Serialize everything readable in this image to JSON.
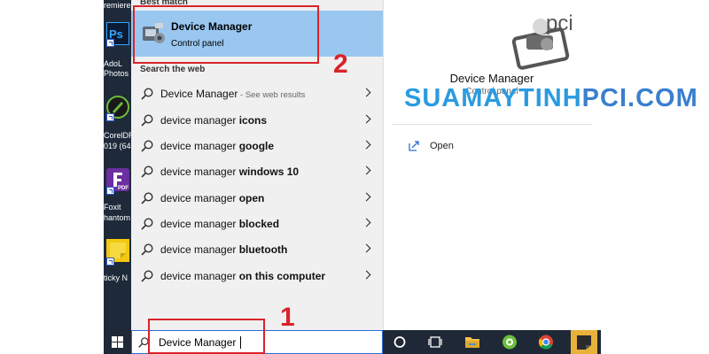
{
  "colors": {
    "accent_highlight": "#99c7f0",
    "annotation_red": "#d9232a",
    "taskbar_bg": "#1f2836",
    "watermark_blue": "#2b9be0"
  },
  "desktop": {
    "items": [
      {
        "label": "remiere",
        "icon": "premiere-icon"
      },
      {
        "label": "AdoL",
        "icon": "photoshop-icon"
      },
      {
        "label": "Photos",
        "icon": "photoshop-icon"
      },
      {
        "label": "CorelDR",
        "icon": "coreldraw-icon"
      },
      {
        "label": "019 (64",
        "icon": "coreldraw-icon"
      },
      {
        "label": "Foxit",
        "icon": "foxit-pdf-icon"
      },
      {
        "label": "hantom",
        "icon": "foxit-pdf-icon"
      },
      {
        "label": "ticky N",
        "icon": "sticky-notes-icon"
      }
    ]
  },
  "best_match": {
    "header": "Best match",
    "title": "Device Manager",
    "subtitle": "Control panel",
    "icon": "device-manager-icon"
  },
  "web": {
    "header": "Search the web",
    "results": [
      {
        "prefix": "Device Manager",
        "bold": "",
        "suffix": " - See web results"
      },
      {
        "prefix": "device manager ",
        "bold": "icons",
        "suffix": ""
      },
      {
        "prefix": "device manager ",
        "bold": "google",
        "suffix": ""
      },
      {
        "prefix": "device manager ",
        "bold": "windows 10",
        "suffix": ""
      },
      {
        "prefix": "device manager ",
        "bold": "open",
        "suffix": ""
      },
      {
        "prefix": "device manager ",
        "bold": "blocked",
        "suffix": ""
      },
      {
        "prefix": "device manager ",
        "bold": "bluetooth",
        "suffix": ""
      },
      {
        "prefix": "device manager ",
        "bold": "on this computer",
        "suffix": ""
      }
    ]
  },
  "preview": {
    "title": "Device Manager",
    "subtitle": "Control panel",
    "actions": [
      {
        "label": "Open",
        "icon": "open-icon"
      }
    ]
  },
  "watermark": {
    "part1": "SUAMAYTINH",
    "part2": "PCI.COM",
    "logo_text": "pci"
  },
  "search": {
    "value": "Device Manager"
  },
  "annotations": {
    "step1": "1",
    "step2": "2"
  },
  "taskbar": {
    "items": [
      {
        "icon": "cortana-icon"
      },
      {
        "icon": "task-view-icon"
      },
      {
        "icon": "file-explorer-icon"
      },
      {
        "icon": "coccoc-browser-icon"
      },
      {
        "icon": "chrome-icon"
      },
      {
        "icon": "sticky-notes-icon"
      }
    ]
  }
}
